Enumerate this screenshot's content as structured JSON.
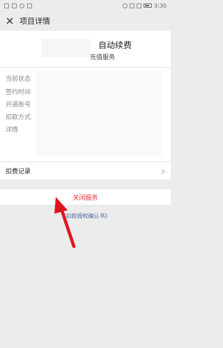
{
  "status_bar": {
    "time": "3:30"
  },
  "nav": {
    "title": "项目详情"
  },
  "card": {
    "title": "自动续费",
    "subtitle": "充值服务"
  },
  "details": {
    "labels": [
      "当前状态",
      "签约时间",
      "开通账号",
      "扣款方式",
      "详情"
    ]
  },
  "records": {
    "label": "扣费记录"
  },
  "actions": {
    "close_service": "关闭服务",
    "auth_link": "《扣款授权确认书》"
  },
  "colors": {
    "danger": "#e0323a",
    "link": "#4a6a9a",
    "arrow": "#e0141e"
  }
}
